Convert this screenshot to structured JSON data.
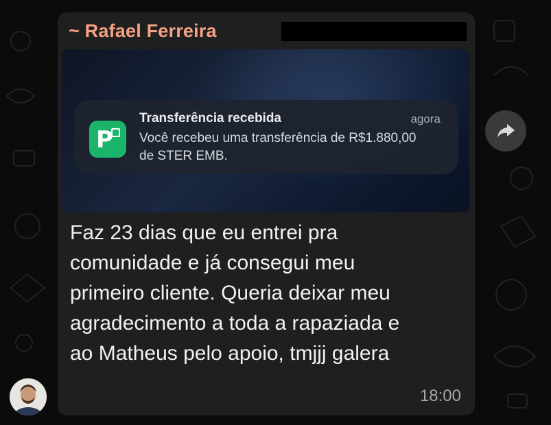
{
  "message": {
    "sender_name": "~ Rafael Ferreira",
    "text": "Faz 23 dias que eu entrei pra comunidade e já consegui meu primeiro cliente. Queria deixar meu agradecimento a toda a rapaziada e ao Matheus pelo apoio, tmjjj galera",
    "time": "18:00"
  },
  "attachment": {
    "notification": {
      "title": "Transferência recebida",
      "time": "agora",
      "body": "Você recebeu uma transferência de R$1.880,00 de STER EMB.",
      "app_icon": "picpay-icon",
      "app_icon_letter": "P"
    }
  },
  "icons": {
    "forward": "forward-arrow-icon",
    "avatar": "user-avatar"
  },
  "colors": {
    "sender_name": "#f5a282",
    "bubble_bg": "#1f1f1f",
    "app_icon_bg": "#1bb46b"
  }
}
